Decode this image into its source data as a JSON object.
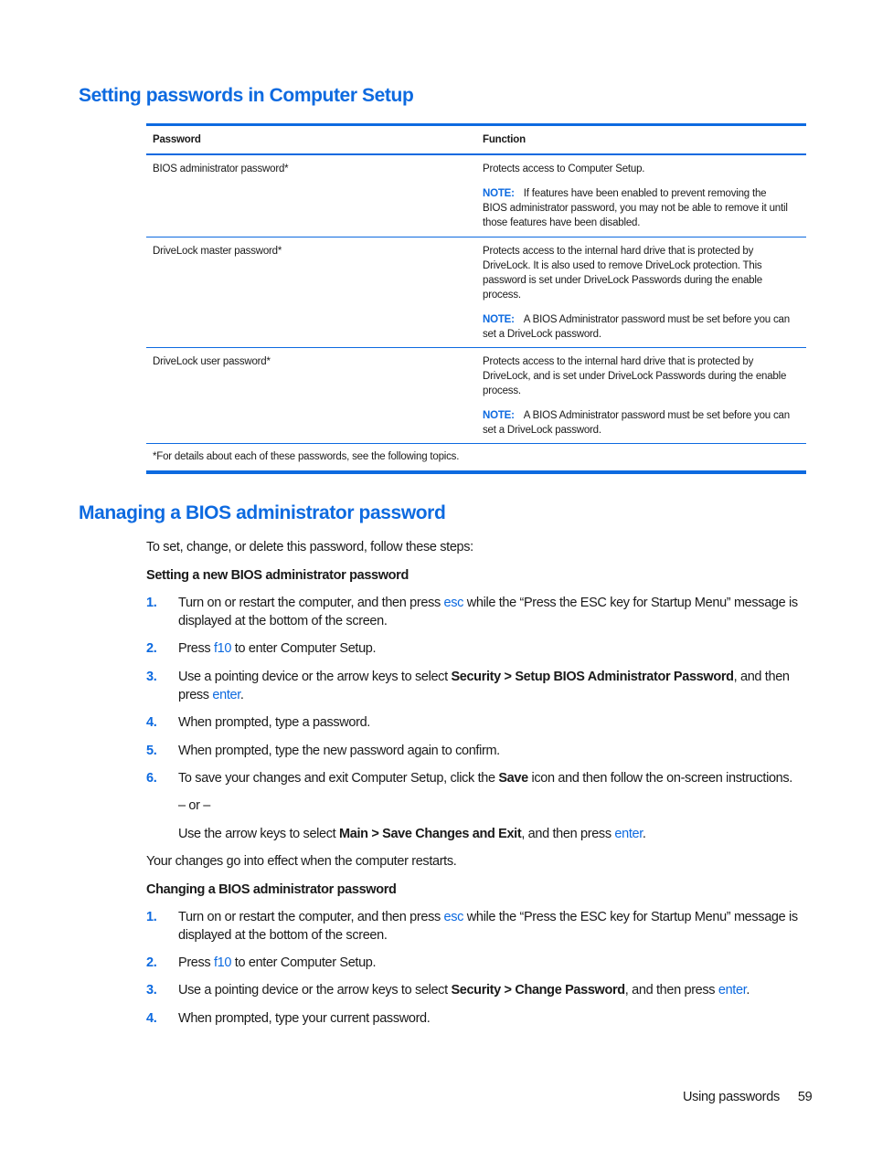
{
  "section1": {
    "title": "Setting passwords in Computer Setup",
    "table": {
      "headers": [
        "Password",
        "Function"
      ],
      "rows": [
        {
          "password": "BIOS administrator password*",
          "function": "Protects access to Computer Setup.",
          "note_label": "NOTE:",
          "note": "If features have been enabled to prevent removing the BIOS administrator password, you may not be able to remove it until those features have been disabled."
        },
        {
          "password": "DriveLock master password*",
          "function": "Protects access to the internal hard drive that is protected by DriveLock. It is also used to remove DriveLock protection. This password is set under DriveLock Passwords during the enable process.",
          "note_label": "NOTE:",
          "note": "A BIOS Administrator password must be set before you can set a DriveLock password."
        },
        {
          "password": "DriveLock user password*",
          "function": "Protects access to the internal hard drive that is protected by DriveLock, and is set under DriveLock Passwords during the enable process.",
          "note_label": "NOTE:",
          "note": "A BIOS Administrator password must be set before you can set a DriveLock password."
        }
      ],
      "footnote": "*For details about each of these passwords, see the following topics."
    }
  },
  "section2": {
    "title": "Managing a BIOS administrator password",
    "intro": "To set, change, or delete this password, follow these steps:",
    "setting": {
      "heading": "Setting a new BIOS administrator password",
      "steps": [
        {
          "num": "1.",
          "a": "Turn on or restart the computer, and then press ",
          "key": "esc",
          "b": " while the “Press the ESC key for Startup Menu” message is displayed at the bottom of the screen."
        },
        {
          "num": "2.",
          "a": "Press ",
          "key": "f10",
          "b": " to enter Computer Setup."
        },
        {
          "num": "3.",
          "a": "Use a pointing device or the arrow keys to select ",
          "bold": "Security > Setup BIOS Administrator Password",
          "c": ", and then press ",
          "key": "enter",
          "d": "."
        },
        {
          "num": "4.",
          "text": "When prompted, type a password."
        },
        {
          "num": "5.",
          "text": "When prompted, type the new password again to confirm."
        },
        {
          "num": "6.",
          "a": "To save your changes and exit Computer Setup, click the ",
          "bold": "Save",
          "b": " icon and then follow the on-screen instructions."
        }
      ],
      "or_label": "– or –",
      "alt": {
        "a": "Use the arrow keys to select ",
        "bold": "Main > Save Changes and Exit",
        "b": ", and then press ",
        "key": "enter",
        "c": "."
      },
      "effect": "Your changes go into effect when the computer restarts."
    },
    "changing": {
      "heading": "Changing a BIOS administrator password",
      "steps": [
        {
          "num": "1.",
          "a": "Turn on or restart the computer, and then press ",
          "key": "esc",
          "b": " while the “Press the ESC key for Startup Menu” message is displayed at the bottom of the screen."
        },
        {
          "num": "2.",
          "a": "Press ",
          "key": "f10",
          "b": " to enter Computer Setup."
        },
        {
          "num": "3.",
          "a": "Use a pointing device or the arrow keys to select ",
          "bold": "Security > Change Password",
          "b": ", and then press ",
          "key": "enter",
          "c": "."
        },
        {
          "num": "4.",
          "text": "When prompted, type your current password."
        }
      ]
    }
  },
  "footer": {
    "section": "Using passwords",
    "page": "59"
  },
  "colors": {
    "accent": "#0d6ae0",
    "text": "#1a1a1a"
  }
}
